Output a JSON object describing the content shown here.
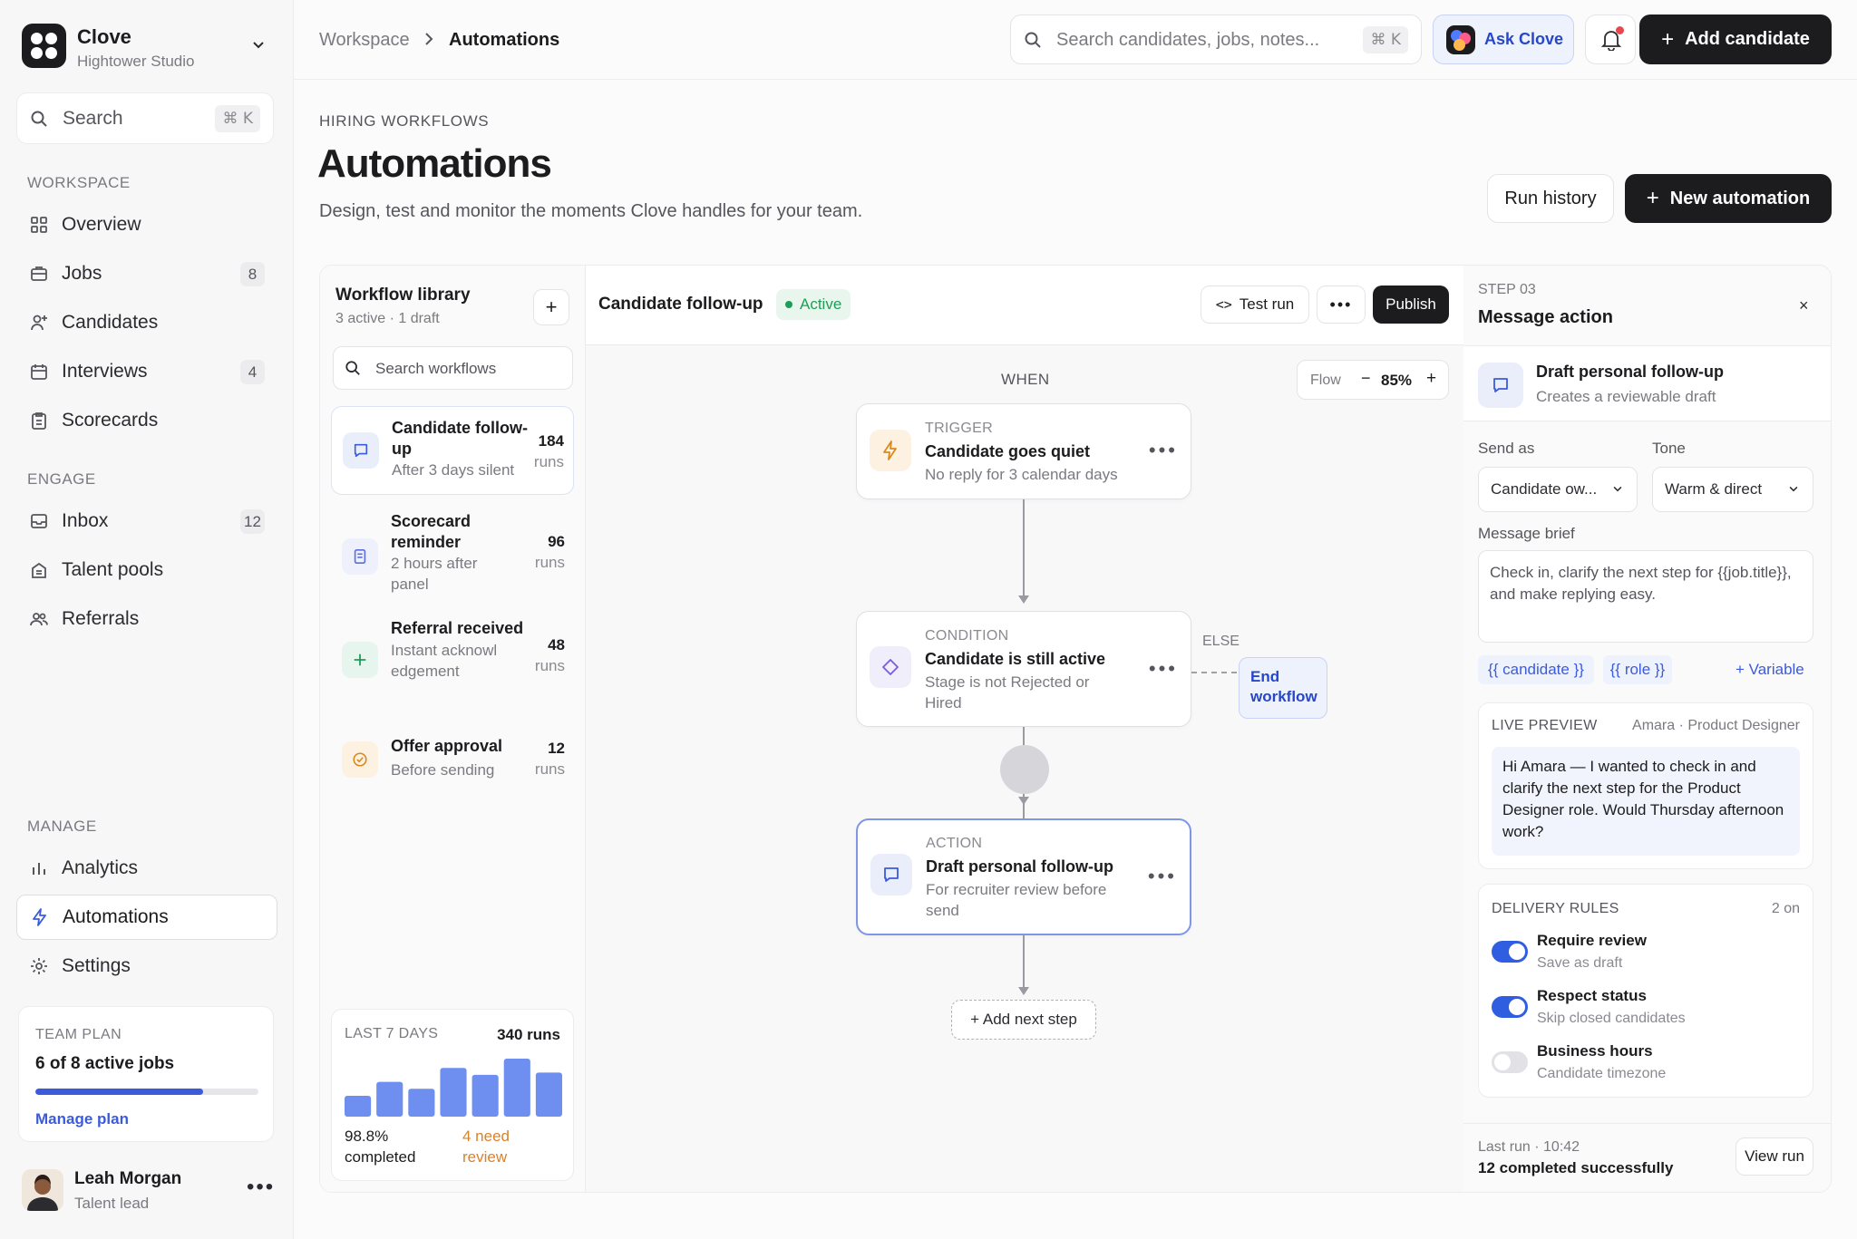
{
  "brand": {
    "name": "Clove",
    "workspace": "Hightower Studio"
  },
  "sidebar": {
    "search": {
      "placeholder": "Search",
      "shortcut": "⌘ K"
    },
    "sections": {
      "workspace": "WORKSPACE",
      "engage": "ENGAGE",
      "manage": "MANAGE"
    },
    "items": [
      {
        "label": "Overview",
        "icon": "grid-icon"
      },
      {
        "label": "Jobs",
        "icon": "briefcase-icon",
        "badge": "8"
      },
      {
        "label": "Candidates",
        "icon": "user-plus-icon"
      },
      {
        "label": "Interviews",
        "icon": "calendar-icon",
        "badge": "4"
      },
      {
        "label": "Scorecards",
        "icon": "clipboard-icon"
      },
      {
        "label": "Inbox",
        "icon": "inbox-icon",
        "badge": "12"
      },
      {
        "label": "Talent pools",
        "icon": "building-icon"
      },
      {
        "label": "Referrals",
        "icon": "users-icon"
      },
      {
        "label": "Analytics",
        "icon": "bar-chart-icon"
      },
      {
        "label": "Automations",
        "icon": "bolt-icon",
        "active": true
      },
      {
        "label": "Settings",
        "icon": "gear-icon"
      }
    ],
    "plan": {
      "label": "TEAM PLAN",
      "title": "6 of 8 active jobs",
      "progress": 0.75,
      "link": "Manage plan"
    },
    "user": {
      "name": "Leah Morgan",
      "role": "Talent lead"
    }
  },
  "header": {
    "breadcrumb": [
      "Workspace",
      "Automations"
    ],
    "search": {
      "placeholder": "Search candidates, jobs, notes...",
      "shortcut": "⌘ K"
    },
    "ask_label": "Ask Clove",
    "add_label": "Add candidate"
  },
  "page": {
    "eyebrow": "HIRING WORKFLOWS",
    "title": "Automations",
    "subtitle": "Design, test and monitor the moments Clove handles for your team.",
    "run_history": "Run history",
    "new_automation": "New automation"
  },
  "library": {
    "title": "Workflow library",
    "meta": "3 active · 1 draft",
    "search_placeholder": "Search workflows",
    "workflows": [
      {
        "title": "Candidate follow-up",
        "sub": "After 3 days silent",
        "runs": "184",
        "runs_label": "runs",
        "icon": "message-icon"
      },
      {
        "title": "Scorecard reminder",
        "sub": "2 hours after panel",
        "runs": "96",
        "runs_label": "runs",
        "icon": "document-icon"
      },
      {
        "title": "Referral received",
        "sub": "Instant acknowledgement",
        "runs": "48",
        "runs_label": "runs",
        "icon": "plus-icon"
      },
      {
        "title": "Offer approval",
        "sub": "Before sending",
        "runs": "12",
        "runs_label": "runs",
        "icon": "check-circle-icon"
      }
    ],
    "stats": {
      "label": "LAST 7 DAYS",
      "total": "340 runs",
      "bars": [
        18,
        30,
        24,
        42,
        36,
        50,
        38
      ],
      "completed": "98.8% completed",
      "review": "4 need review"
    }
  },
  "canvas": {
    "workflow_name": "Candidate follow-up",
    "status": "Active",
    "test_run": "Test run",
    "publish": "Publish",
    "when": "WHEN",
    "zoom_label": "Flow",
    "zoom": "85%",
    "trigger": {
      "label": "TRIGGER",
      "title": "Candidate goes quiet",
      "sub": "No reply for 3 calendar days"
    },
    "condition": {
      "label": "CONDITION",
      "title": "Candidate is still active",
      "sub": "Stage is not Rejected or Hired"
    },
    "else_label": "ELSE",
    "end_workflow": "End workflow",
    "action": {
      "label": "ACTION",
      "title": "Draft personal follow-up",
      "sub": "For recruiter review before send"
    },
    "add_step": "+ Add next step"
  },
  "inspector": {
    "step": "STEP 03",
    "title": "Message action",
    "summary": {
      "title": "Draft personal follow-up",
      "sub": "Creates a reviewable draft"
    },
    "send_as_label": "Send as",
    "send_as_value": "Candidate ow...",
    "tone_label": "Tone",
    "tone_value": "Warm & direct",
    "brief_label": "Message brief",
    "brief_text": "Check in, clarify the next step for {{job.title}}, and make replying easy.",
    "chips": [
      "{{ candidate }}",
      "{{ role }}"
    ],
    "variable": "+ Variable",
    "preview_label": "LIVE PREVIEW",
    "preview_for": "Amara · Product Designer",
    "preview_text": "Hi Amara — I wanted to check in and clarify the next step for the Product Designer role. Would Thursday afternoon work?",
    "rules_label": "DELIVERY RULES",
    "rules_count": "2 on",
    "rules": [
      {
        "title": "Require review",
        "sub": "Save as draft",
        "on": true
      },
      {
        "title": "Respect status",
        "sub": "Skip closed candidates",
        "on": true
      },
      {
        "title": "Business hours",
        "sub": "Candidate timezone",
        "on": false
      }
    ],
    "last_run": "Last run · 10:42",
    "last_result": "12 completed successfully",
    "view_run": "View run"
  },
  "colors": {
    "accent": "#3b5bdb",
    "dark": "#1c1c1f",
    "success": "#1f9d55"
  }
}
